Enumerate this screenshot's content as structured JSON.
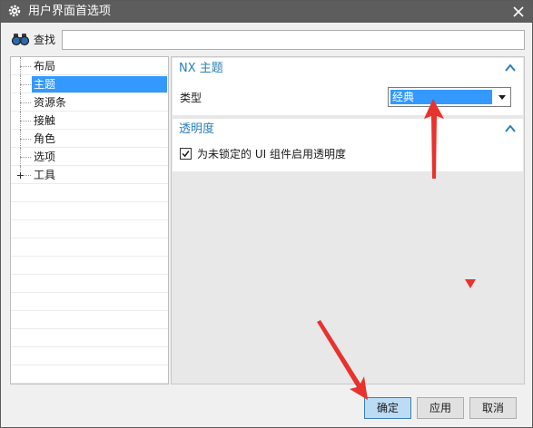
{
  "window": {
    "title": "用户界面首选项",
    "icons": {
      "app": "gear-icon",
      "close": "close-icon"
    }
  },
  "search": {
    "label": "查找",
    "value": "",
    "icon": "binoculars-icon"
  },
  "tree": {
    "items": [
      {
        "label": "布局",
        "selected": false,
        "expandable": false
      },
      {
        "label": "主题",
        "selected": true,
        "expandable": false
      },
      {
        "label": "资源条",
        "selected": false,
        "expandable": false
      },
      {
        "label": "接触",
        "selected": false,
        "expandable": false
      },
      {
        "label": "角色",
        "selected": false,
        "expandable": false
      },
      {
        "label": "选项",
        "selected": false,
        "expandable": false
      },
      {
        "label": "工具",
        "selected": false,
        "expandable": true
      }
    ]
  },
  "panel": {
    "theme_group": {
      "title": "NX 主题",
      "type_label": "类型",
      "type_value": "经典",
      "collapse_icon": "chevron-up-icon"
    },
    "transparency_group": {
      "title": "透明度",
      "checkbox_label": "为未锁定的 UI 组件启用透明度",
      "checked": true,
      "collapse_icon": "chevron-up-icon"
    }
  },
  "buttons": {
    "ok": "确定",
    "apply": "应用",
    "cancel": "取消"
  },
  "colors": {
    "titlebar": "#5d5d5d",
    "selection": "#3399ff",
    "group_title": "#2980b9",
    "annotation_arrow": "#e8322d"
  }
}
